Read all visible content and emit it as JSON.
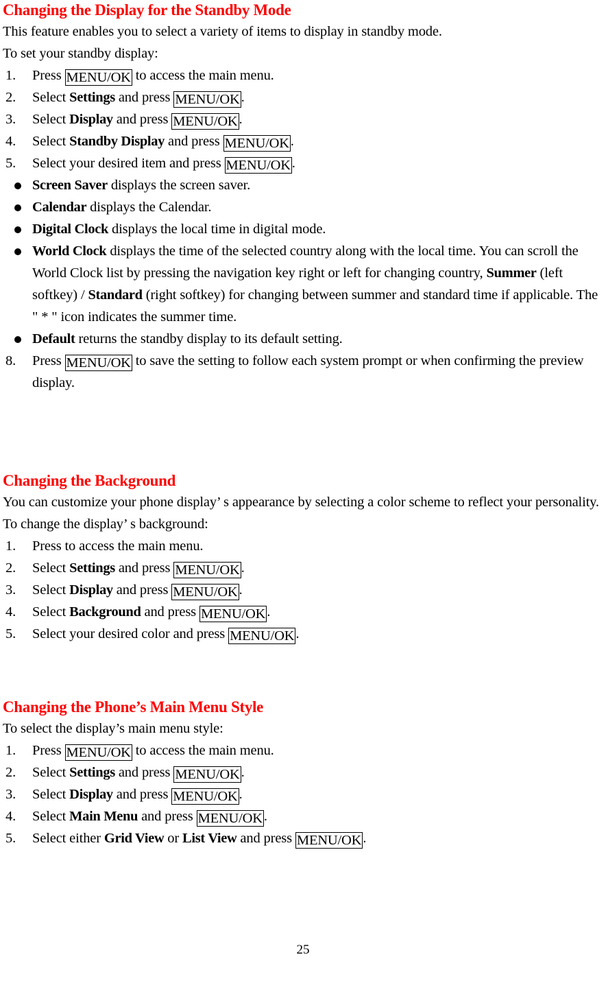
{
  "document": {
    "page_number": "25",
    "heading_color": "#FF0000",
    "text_color": "#000000",
    "key_label": "MENU/OK"
  },
  "sections": [
    {
      "heading": "Changing the Display for the Standby Mode",
      "intro": [
        "This feature enables you to select a variety of items to display in standby mode.",
        "To set your standby display:"
      ],
      "steps": [
        {
          "num": "1.",
          "pre": "Press ",
          "key": "MENU/OK",
          "post": " to access the main menu."
        },
        {
          "num": "2.",
          "pre": "Select ",
          "bold": "Settings",
          "mid": " and press ",
          "key": "MENU/OK",
          "post": "."
        },
        {
          "num": "3.",
          "pre": "Select ",
          "bold": "Display",
          "mid": " and press ",
          "key": "MENU/OK",
          "post": "."
        },
        {
          "num": "4.",
          "pre": "Select ",
          "bold": "Standby Display",
          "mid": " and press ",
          "key": "MENU/OK",
          "post": "."
        },
        {
          "num": "5.",
          "pre": "Select your desired item and press ",
          "key": "MENU/OK",
          "post": "."
        }
      ],
      "bullets": [
        {
          "bold": "Screen Saver",
          "text": " displays the screen saver."
        },
        {
          "bold": "Calendar",
          "text": " displays the Calendar."
        },
        {
          "bold": "Digital Clock",
          "text": " displays the local time in digital mode."
        },
        {
          "bold": "World Clock",
          "text": " displays the time of the selected country along with the local time. You can scroll the World Clock list by pressing the navigation key right or left for changing country, ",
          "bold2": "Summer",
          "text2": " (left softkey) / ",
          "bold3": "Standard",
          "text3": " (right softkey) for changing between summer and standard time if applicable. The \" * \" icon indicates the summer time."
        },
        {
          "bold": "Default",
          "text": " returns the standby display to its default setting."
        }
      ],
      "final_step": {
        "num": "8.",
        "pre": "Press ",
        "key": "MENU/OK",
        "post": " to save the setting to follow each system prompt or when confirming the preview display."
      }
    },
    {
      "heading": "Changing the Background",
      "intro": [
        "You can customize your phone display’ s appearance by selecting a color scheme to reflect your personality.",
        "To change the display’ s background:"
      ],
      "steps": [
        {
          "num": "1.",
          "pre": "Press to access the main menu."
        },
        {
          "num": "2.",
          "pre": "Select ",
          "bold": "Settings",
          "mid": " and press ",
          "key": "MENU/OK",
          "post": "."
        },
        {
          "num": "3.",
          "pre": "Select ",
          "bold": "Display",
          "mid": " and press ",
          "key": "MENU/OK",
          "post": "."
        },
        {
          "num": "4.",
          "pre": "Select ",
          "bold": "Background",
          "mid": " and press ",
          "key": "MENU/OK",
          "post": "."
        },
        {
          "num": "5.",
          "pre": "Select your desired color and press ",
          "key": "MENU/OK",
          "post": "."
        }
      ]
    },
    {
      "heading": "Changing the Phone’s Main Menu Style",
      "intro": [
        "To select the display’s main menu style:"
      ],
      "steps": [
        {
          "num": "1.",
          "pre": "Press ",
          "key": "MENU/OK",
          "post": " to access the main menu."
        },
        {
          "num": "2.",
          "pre": "Select ",
          "bold": "Settings",
          "mid": " and press ",
          "key": "MENU/OK",
          "post": "."
        },
        {
          "num": "3.",
          "pre": "Select ",
          "bold": "Display",
          "mid": " and press ",
          "key": "MENU/OK",
          "post": "."
        },
        {
          "num": "4.",
          "pre": "Select ",
          "bold": "Main Menu",
          "mid": " and press ",
          "key": "MENU/OK",
          "post": "."
        },
        {
          "num": "5.",
          "pre": "Select either ",
          "bold": "Grid View",
          "mid": " or ",
          "bold2": "List View",
          "mid2": " and press ",
          "key": "MENU/OK",
          "post": "."
        }
      ]
    }
  ]
}
